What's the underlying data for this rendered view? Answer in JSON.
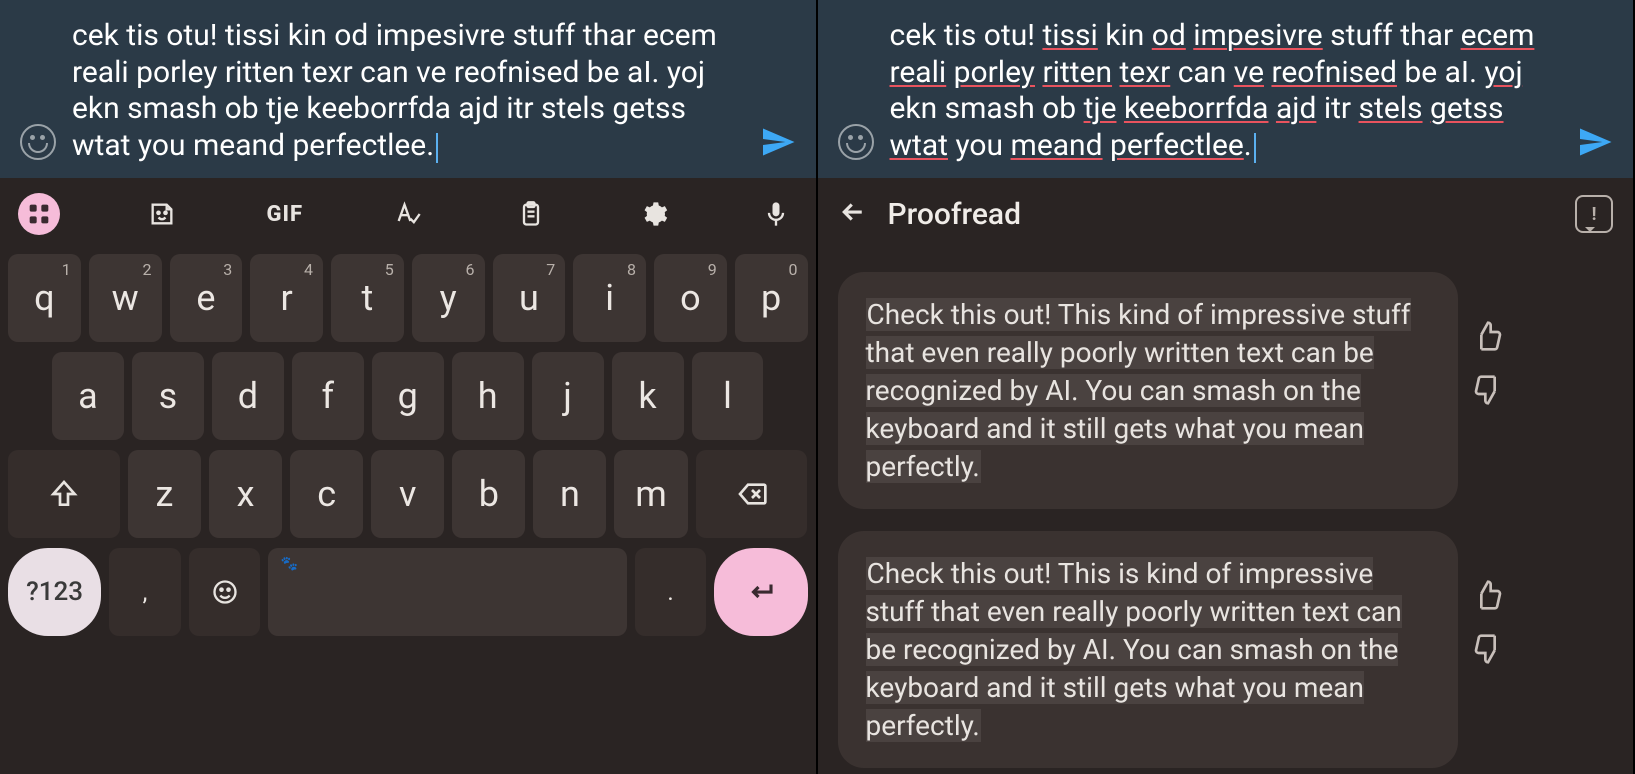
{
  "left": {
    "message_text": "cek tis otu! tissi kin od impesivre stuff thar ecem reali porley ritten texr can ve reofnised be aI. yoj ekn smash ob tje keeborrfda ajd itr stels getss wtat you meand perfectlee."
  },
  "right": {
    "message_parts": [
      {
        "t": "cek tis otu! ",
        "u": false
      },
      {
        "t": "tissi",
        "u": true
      },
      {
        "t": " kin ",
        "u": false
      },
      {
        "t": "od",
        "u": true
      },
      {
        "t": " ",
        "u": false
      },
      {
        "t": "impesivre",
        "u": true
      },
      {
        "t": " stuff thar ",
        "u": false
      },
      {
        "t": "ecem",
        "u": true
      },
      {
        "t": " ",
        "u": false
      },
      {
        "t": "reali",
        "u": true
      },
      {
        "t": " ",
        "u": false
      },
      {
        "t": "porley",
        "u": true
      },
      {
        "t": " ",
        "u": false
      },
      {
        "t": "ritten",
        "u": true
      },
      {
        "t": " ",
        "u": false
      },
      {
        "t": "texr",
        "u": true
      },
      {
        "t": " can ",
        "u": false
      },
      {
        "t": "ve",
        "u": true
      },
      {
        "t": " ",
        "u": false
      },
      {
        "t": "reofnised",
        "u": true
      },
      {
        "t": " be aI. ",
        "u": false
      },
      {
        "t": "yoj",
        "u": true
      },
      {
        "t": " ekn smash ob ",
        "u": false
      },
      {
        "t": "tje",
        "u": true
      },
      {
        "t": " ",
        "u": false
      },
      {
        "t": "keeborrfda",
        "u": true
      },
      {
        "t": " ",
        "u": false
      },
      {
        "t": "ajd",
        "u": true
      },
      {
        "t": " itr ",
        "u": false
      },
      {
        "t": "stels",
        "u": true
      },
      {
        "t": " ",
        "u": false
      },
      {
        "t": "getss",
        "u": true
      },
      {
        "t": " ",
        "u": false
      },
      {
        "t": "wtat",
        "u": true
      },
      {
        "t": " you ",
        "u": false
      },
      {
        "t": "meand",
        "u": true
      },
      {
        "t": " ",
        "u": false
      },
      {
        "t": "perfectlee",
        "u": true
      },
      {
        "t": ".",
        "u": false
      }
    ],
    "header_title": "Proofread",
    "suggestions": [
      "Check this out! This kind of impressive stuff that even really poorly written text can be recognized by AI. You can smash on the keyboard and it still gets what you mean perfectly.",
      "Check this out! This is kind of impressive stuff that even really poorly written text can be recognized by AI. You can smash on the keyboard and it still gets what you mean perfectly."
    ]
  },
  "keyboard": {
    "gif_label": "GIF",
    "row1": [
      {
        "k": "q",
        "n": "1"
      },
      {
        "k": "w",
        "n": "2"
      },
      {
        "k": "e",
        "n": "3"
      },
      {
        "k": "r",
        "n": "4"
      },
      {
        "k": "t",
        "n": "5"
      },
      {
        "k": "y",
        "n": "6"
      },
      {
        "k": "u",
        "n": "7"
      },
      {
        "k": "i",
        "n": "8"
      },
      {
        "k": "o",
        "n": "9"
      },
      {
        "k": "p",
        "n": "0"
      }
    ],
    "row2": [
      "a",
      "s",
      "d",
      "f",
      "g",
      "h",
      "j",
      "k",
      "l"
    ],
    "row3": [
      "z",
      "x",
      "c",
      "v",
      "b",
      "n",
      "m"
    ],
    "symnum_label": "?123",
    "comma": ",",
    "period": "."
  }
}
